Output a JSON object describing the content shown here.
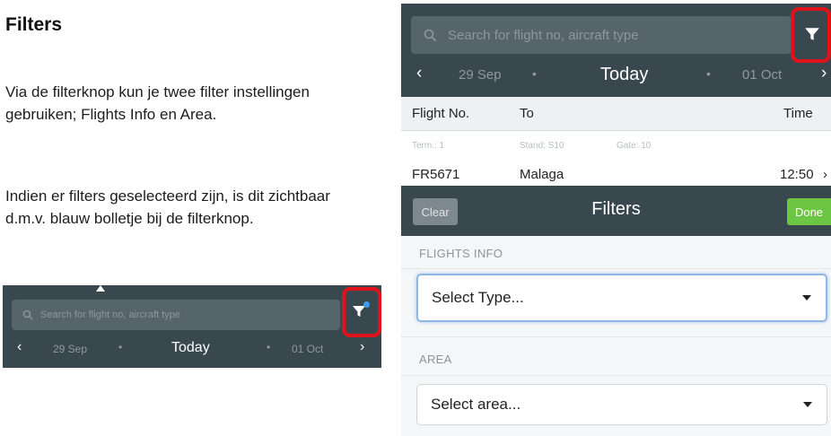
{
  "document": {
    "title": "Filters",
    "paragraph1": "Via de filterknop kun je twee filter instellingen gebruiken; Flights Info en Area.",
    "paragraph2": "Indien er filters geselecteerd zijn, is dit zichtbaar d.m.v. blauw bolletje bij de filterknop."
  },
  "mini_header": {
    "search_placeholder": "Search for flight no, aircraft type",
    "prev_date": "29 Sep",
    "current_date": "Today",
    "next_date": "01 Oct",
    "prev_arrow": "‹",
    "next_arrow": "›",
    "bullet": "•",
    "filter_active_dot_color": "#3c9df0"
  },
  "app_header": {
    "search_placeholder": "Search for flight no, aircraft type",
    "prev_date": "29 Sep",
    "current_date": "Today",
    "next_date": "01 Oct",
    "prev_arrow": "‹",
    "next_arrow": "›",
    "bullet": "•"
  },
  "flight_table": {
    "columns": [
      "Flight No.",
      "To",
      "Time"
    ],
    "sub_row": {
      "term": "Term.: 1",
      "stand": "Stand: S10",
      "gate": "Gate: 10"
    },
    "row": {
      "flight_no": "FR5671",
      "to": "Malaga",
      "time": "12:50",
      "chevron": "›"
    }
  },
  "filters_panel": {
    "title": "Filters",
    "clear_label": "Clear",
    "done_label": "Done",
    "flights_info_label": "FLIGHTS INFO",
    "type_select_value": "Select Type...",
    "area_label": "AREA",
    "area_select_value": "Select area..."
  },
  "colors": {
    "header_bg": "#39474e",
    "highlight_red": "#e0131b",
    "done_green": "#6cc644",
    "focus_blue": "#8eb8e6"
  }
}
